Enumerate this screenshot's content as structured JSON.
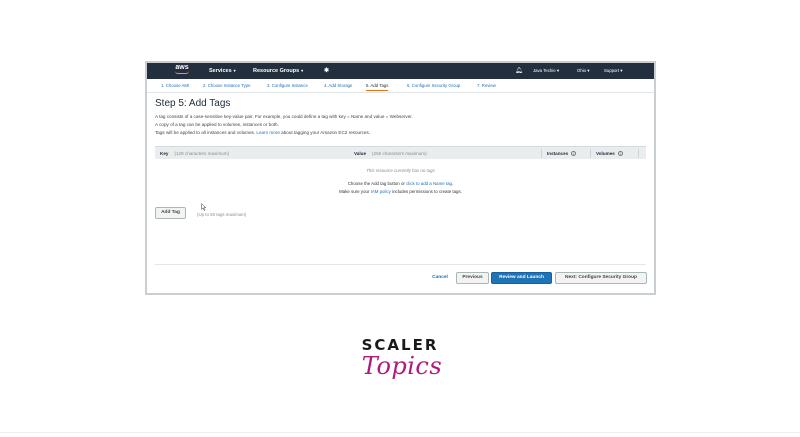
{
  "topbar": {
    "logo_text": "aws",
    "services": "Services",
    "resource_groups": "Resource Groups",
    "pin_icon": "pin-icon",
    "bell_icon": "bell-icon",
    "user": "Java Techie",
    "region": "Ohio",
    "support": "Support"
  },
  "steps": [
    {
      "label": "1. Choose AMI"
    },
    {
      "label": "2. Choose Instance Type"
    },
    {
      "label": "3. Configure Instance"
    },
    {
      "label": "4. Add Storage"
    },
    {
      "label": "5. Add Tags"
    },
    {
      "label": "6. Configure Security Group"
    },
    {
      "label": "7. Review"
    }
  ],
  "page": {
    "title": "Step 5: Add Tags",
    "desc1": "A tag consists of a case-sensitive key-value pair. For example, you could define a tag with key = Name and value = Webserver.",
    "desc2": "A copy of a tag can be applied to volumes, instances or both.",
    "desc3_pre": "Tags will be applied to all instances and volumes.",
    "desc3_link": "Learn more",
    "desc3_post": "about tagging your Amazon EC2 resources."
  },
  "table": {
    "key_label": "Key",
    "key_hint": "(128 characters maximum)",
    "value_label": "Value",
    "value_hint": "(256 characters maximum)",
    "instances_label": "Instances",
    "volumes_label": "Volumes",
    "info_glyph": "i",
    "empty_msg": "This resource currently has no tags",
    "empty_pre": "Choose the Add tag button or",
    "empty_link": "click to add a Name tag",
    "empty_post": ".",
    "policy_pre": "Make sure your",
    "policy_link": "IAM policy",
    "policy_post": "includes permissions to create tags."
  },
  "actions": {
    "add_tag": "Add Tag",
    "limit": "(Up to 50 tags maximum)",
    "cancel": "Cancel",
    "previous": "Previous",
    "review": "Review and Launch",
    "next": "Next: Configure Security Group"
  },
  "brand": {
    "scaler": "SCALER",
    "topics": "Topics",
    "accent": "#b0197a"
  }
}
